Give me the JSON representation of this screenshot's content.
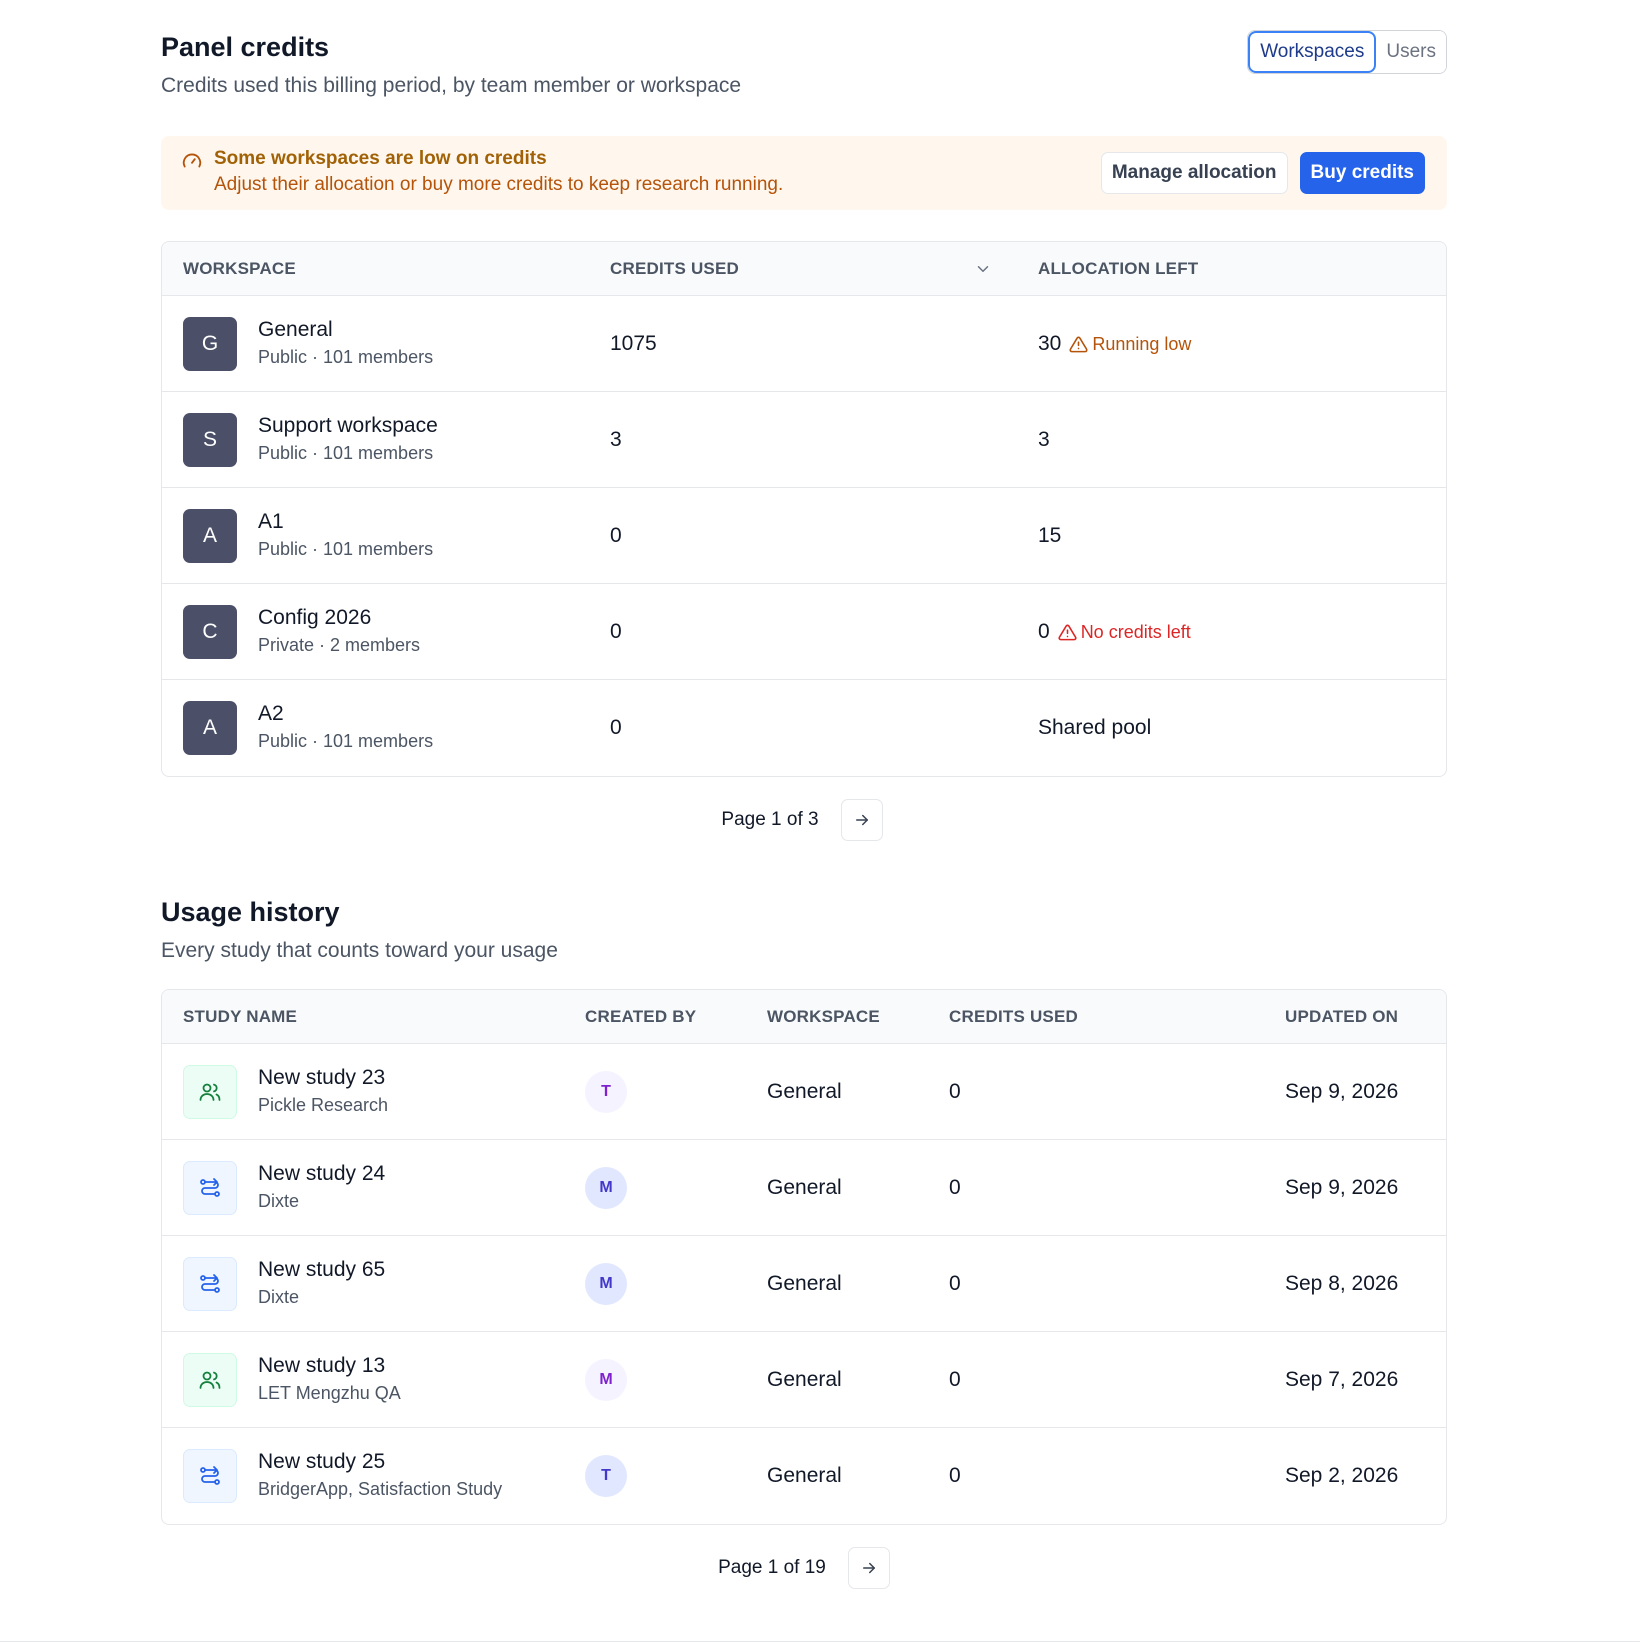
{
  "panel_credits": {
    "title": "Panel credits",
    "subtitle": "Credits used this billing period, by team member or workspace",
    "toggle": {
      "workspaces": "Workspaces",
      "users": "Users",
      "active": "Workspaces"
    }
  },
  "alert": {
    "icon": "gauge-icon",
    "title": "Some workspaces are low on credits",
    "text": "Adjust their allocation or buy more credits to keep research running.",
    "manage_label": "Manage allocation",
    "buy_label": "Buy credits"
  },
  "workspaces_table": {
    "headers": {
      "workspace": "WORKSPACE",
      "credits_used": "CREDITS USED",
      "allocation_left": "ALLOCATION LEFT"
    },
    "rows": [
      {
        "initial": "G",
        "name": "General",
        "meta": "Public · 101 members",
        "credits_used": "1075",
        "allocation_left": "30",
        "status": "Running low"
      },
      {
        "initial": "S",
        "name": "Support workspace",
        "meta": "Public · 101 members",
        "credits_used": "3",
        "allocation_left": "3",
        "status": ""
      },
      {
        "initial": "A",
        "name": "A1",
        "meta": "Public · 101 members",
        "credits_used": "0",
        "allocation_left": "15",
        "status": ""
      },
      {
        "initial": "C",
        "name": "Config 2026",
        "meta": "Private · 2 members",
        "credits_used": "0",
        "allocation_left": "0",
        "status": "No credits left"
      },
      {
        "initial": "A",
        "name": "A2",
        "meta": "Public · 101 members",
        "credits_used": "0",
        "allocation_left": "Shared pool",
        "status": ""
      }
    ],
    "pager": "Page 1 of 3"
  },
  "usage_history": {
    "title": "Usage history",
    "subtitle": "Every study that counts toward your usage",
    "headers": {
      "study_name": "STUDY NAME",
      "created_by": "CREATED BY",
      "workspace": "WORKSPACE",
      "credits_used": "CREDITS USED",
      "updated_on": "UPDATED ON"
    },
    "rows": [
      {
        "icon": "people-icon",
        "name": "New study 23",
        "sub": "Pickle Research",
        "created_by": "T",
        "workspace": "General",
        "credits_used": "0",
        "updated_on": "Sep 9, 2026"
      },
      {
        "icon": "flow-icon",
        "name": "New study 24",
        "sub": "Dixte",
        "created_by": "M",
        "workspace": "General",
        "credits_used": "0",
        "updated_on": "Sep 9, 2026"
      },
      {
        "icon": "flow-icon",
        "name": "New study 65",
        "sub": "Dixte",
        "created_by": "M",
        "workspace": "General",
        "credits_used": "0",
        "updated_on": "Sep 8, 2026"
      },
      {
        "icon": "people-icon",
        "name": "New study 13",
        "sub": "LET Mengzhu QA",
        "created_by": "M",
        "workspace": "General",
        "credits_used": "0",
        "updated_on": "Sep 7, 2026"
      },
      {
        "icon": "flow-icon",
        "name": "New study 25",
        "sub": "BridgerApp, Satisfaction Study",
        "created_by": "T",
        "workspace": "General",
        "credits_used": "0",
        "updated_on": "Sep 2, 2026"
      }
    ],
    "pager": "Page 1 of 19"
  }
}
